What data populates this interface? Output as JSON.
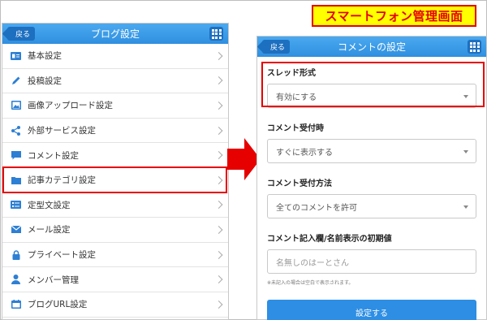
{
  "banner": {
    "title": "スマートフォン管理画面"
  },
  "left_screen": {
    "back_label": "戻る",
    "title": "ブログ設定",
    "menu": [
      {
        "label": "基本設定",
        "icon": "id-card-icon"
      },
      {
        "label": "投稿設定",
        "icon": "pencil-icon"
      },
      {
        "label": "画像アップロード設定",
        "icon": "image-icon"
      },
      {
        "label": "外部サービス設定",
        "icon": "share-icon"
      },
      {
        "label": "コメント設定",
        "icon": "comment-icon"
      },
      {
        "label": "記事カテゴリ設定",
        "icon": "folder-icon"
      },
      {
        "label": "定型文設定",
        "icon": "template-icon"
      },
      {
        "label": "メール設定",
        "icon": "mail-icon"
      },
      {
        "label": "プライベート設定",
        "icon": "lock-icon"
      },
      {
        "label": "メンバー管理",
        "icon": "user-icon"
      },
      {
        "label": "ブログURL設定",
        "icon": "calendar-icon"
      }
    ]
  },
  "right_screen": {
    "back_label": "戻る",
    "title": "コメントの設定",
    "fields": {
      "thread_label": "スレッド形式",
      "thread_value": "有効にする",
      "accept_timing_label": "コメント受付時",
      "accept_timing_value": "すぐに表示する",
      "accept_method_label": "コメント受付方法",
      "accept_method_value": "全てのコメントを許可",
      "default_name_label": "コメント記入欄/名前表示の初期値",
      "default_name_value": "名無しのはーとさん",
      "note": "※未記入の場合は空白で表示されます。"
    },
    "submit_label": "設定する"
  },
  "colors": {
    "accent_blue": "#2d8ee3",
    "highlight_red": "#e60000",
    "banner_yellow": "#ffff00"
  }
}
